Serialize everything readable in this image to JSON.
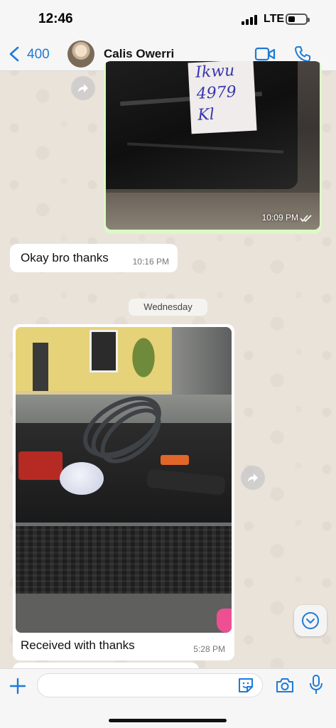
{
  "status_bar": {
    "time": "12:46",
    "network": "LTE"
  },
  "header": {
    "back_count": "400",
    "contact_name": "Calis Owerri",
    "icons": [
      "back-chevron-icon",
      "video-call-icon",
      "phone-call-icon"
    ]
  },
  "messages": [
    {
      "type": "image",
      "direction": "outgoing",
      "image_label_lines": [
        "Ikwu",
        "4979",
        "Kl"
      ],
      "time": "10:09 PM",
      "status": "read"
    },
    {
      "type": "text",
      "direction": "incoming",
      "text": "Okay bro thanks",
      "time": "10:16 PM"
    },
    {
      "type": "date",
      "text": "Wednesday"
    },
    {
      "type": "image",
      "direction": "incoming",
      "caption": "Received with thanks",
      "time": "5:28 PM"
    }
  ],
  "composer": {
    "input_value": "",
    "input_placeholder": ""
  },
  "colors": {
    "accent": "#1e7ad6",
    "outgoing_bubble": "#dcf8c6",
    "incoming_bubble": "#ffffff",
    "chat_background": "#e9e3da"
  }
}
